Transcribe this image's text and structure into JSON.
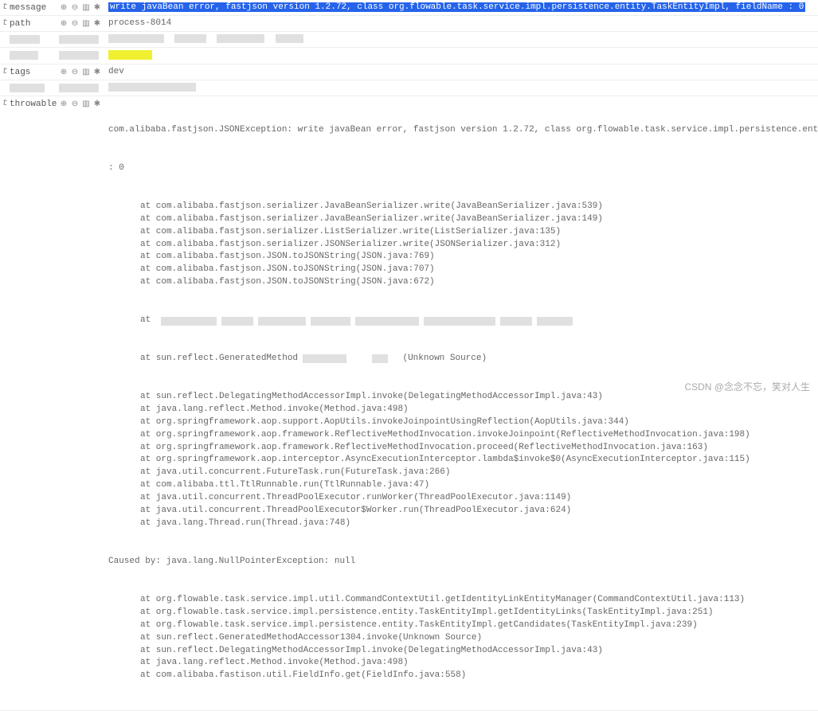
{
  "rows": {
    "message": {
      "type": "t",
      "field": "message",
      "value": "write javaBean error, fastjson version 1.2.72, class org.flowable.task.service.impl.persistence.entity.TaskEntityImpl, fieldName : 0"
    },
    "path": {
      "type": "t",
      "field": "path",
      "value": "process-8014"
    },
    "tags": {
      "type": "t",
      "field": "tags",
      "value": "dev"
    },
    "throwable": {
      "type": "t",
      "field": "throwable",
      "header": "com.alibaba.fastjson.JSONException: write javaBean error, fastjson version 1.2.72, class org.flowable.task.service.impl.persistence.entity.TaskEntityImpl, fieldName",
      "header2": ": 0",
      "lines": [
        "at com.alibaba.fastjson.serializer.JavaBeanSerializer.write(JavaBeanSerializer.java:539)",
        "at com.alibaba.fastjson.serializer.JavaBeanSerializer.write(JavaBeanSerializer.java:149)",
        "at com.alibaba.fastjson.serializer.ListSerializer.write(ListSerializer.java:135)",
        "at com.alibaba.fastjson.serializer.JSONSerializer.write(JSONSerializer.java:312)",
        "at com.alibaba.fastjson.JSON.toJSONString(JSON.java:769)",
        "at com.alibaba.fastjson.JSON.toJSONString(JSON.java:707)",
        "at com.alibaba.fastjson.JSON.toJSONString(JSON.java:672)"
      ],
      "redacted_at": "at ",
      "redacted_line2a": "at sun.reflect.GeneratedMethod",
      "redacted_line2b": "(Unknown Source)",
      "lines2": [
        "at sun.reflect.DelegatingMethodAccessorImpl.invoke(DelegatingMethodAccessorImpl.java:43)",
        "at java.lang.reflect.Method.invoke(Method.java:498)",
        "at org.springframework.aop.support.AopUtils.invokeJoinpointUsingReflection(AopUtils.java:344)",
        "at org.springframework.aop.framework.ReflectiveMethodInvocation.invokeJoinpoint(ReflectiveMethodInvocation.java:198)",
        "at org.springframework.aop.framework.ReflectiveMethodInvocation.proceed(ReflectiveMethodInvocation.java:163)",
        "at org.springframework.aop.interceptor.AsyncExecutionInterceptor.lambda$invoke$0(AsyncExecutionInterceptor.java:115)",
        "at java.util.concurrent.FutureTask.run(FutureTask.java:266)",
        "at com.alibaba.ttl.TtlRunnable.run(TtlRunnable.java:47)",
        "at java.util.concurrent.ThreadPoolExecutor.runWorker(ThreadPoolExecutor.java:1149)",
        "at java.util.concurrent.ThreadPoolExecutor$Worker.run(ThreadPoolExecutor.java:624)",
        "at java.lang.Thread.run(Thread.java:748)"
      ],
      "caused_by": "Caused by: java.lang.NullPointerException: null",
      "lines3": [
        "at org.flowable.task.service.impl.util.CommandContextUtil.getIdentityLinkEntityManager(CommandContextUtil.java:113)",
        "at org.flowable.task.service.impl.persistence.entity.TaskEntityImpl.getIdentityLinks(TaskEntityImpl.java:251)",
        "at org.flowable.task.service.impl.persistence.entity.TaskEntityImpl.getCandidates(TaskEntityImpl.java:239)",
        "at sun.reflect.GeneratedMethodAccessor1304.invoke(Unknown Source)",
        "at sun.reflect.DelegatingMethodAccessorImpl.invoke(DelegatingMethodAccessorImpl.java:43)",
        "at java.lang.reflect.Method.invoke(Method.java:498)",
        "at com.alibaba.fastison.util.FieldInfo.get(FieldInfo.java:558)"
      ]
    }
  },
  "icons": {
    "zoom_in": "⊕",
    "zoom_out": "⊖",
    "columns": "▥",
    "filter": "✱"
  },
  "watermark": "CSDN @念念不忘，笑对人生"
}
